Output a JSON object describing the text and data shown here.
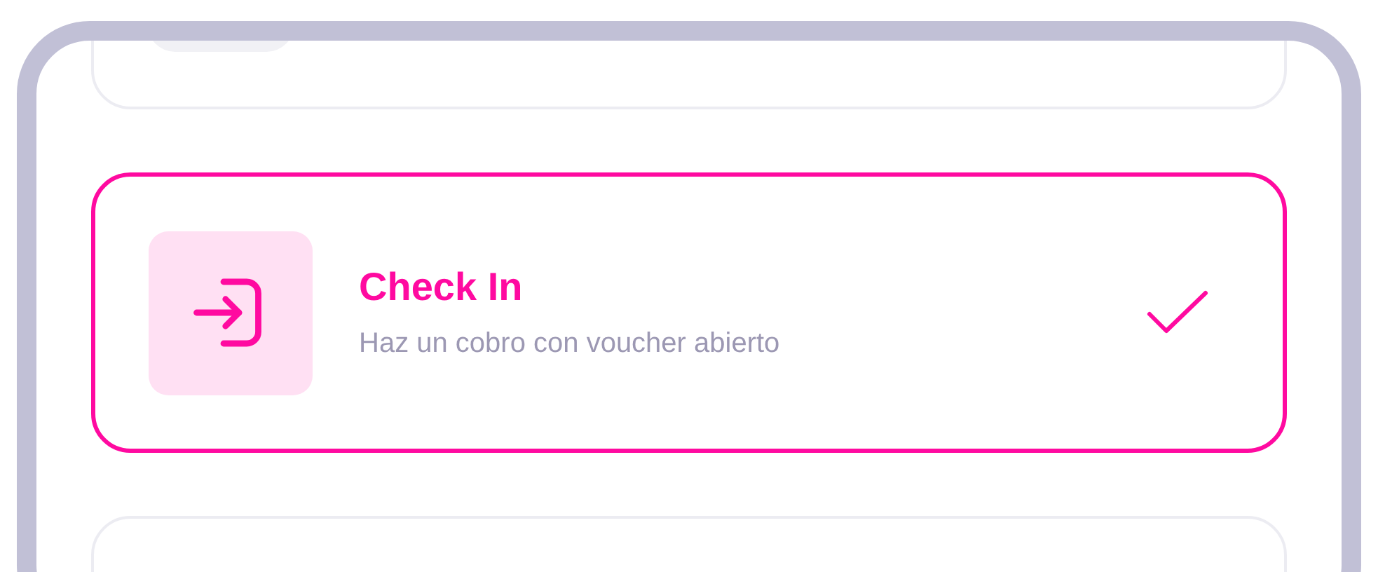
{
  "options": [
    {
      "selected": false
    },
    {
      "title": "Check In",
      "subtitle": "Haz un cobro con voucher abierto",
      "selected": true
    },
    {
      "selected": false
    }
  ]
}
